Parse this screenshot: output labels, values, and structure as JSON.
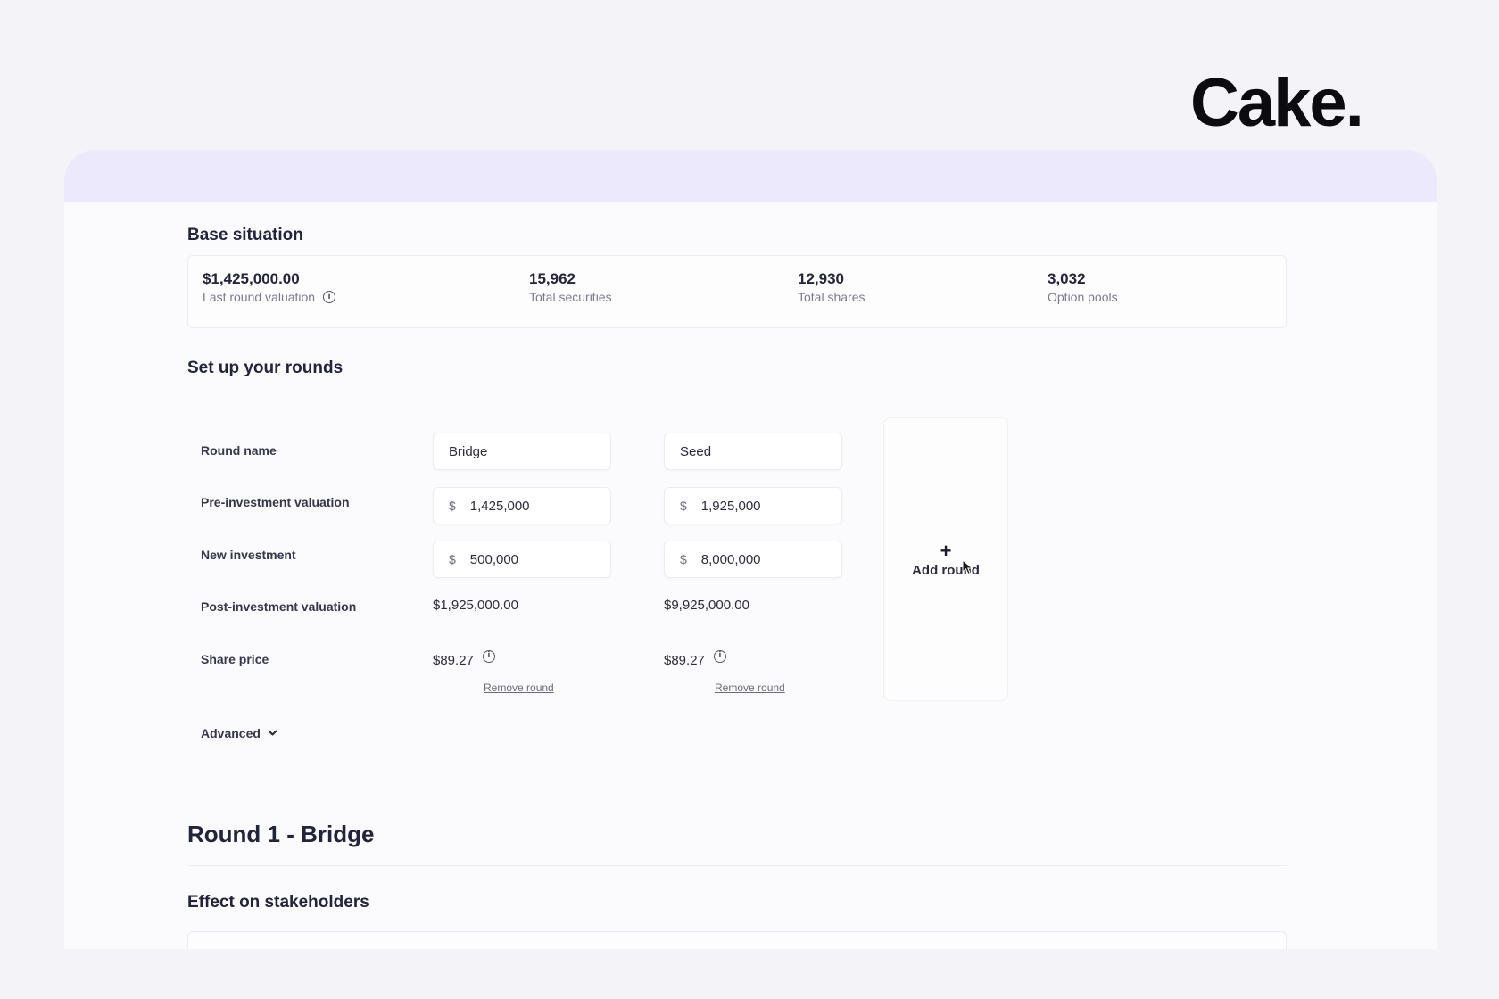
{
  "brand": {
    "name": "Cake."
  },
  "base": {
    "title": "Base situation",
    "stats": [
      {
        "value": "$1,425,000.00",
        "label": "Last round valuation",
        "info": true
      },
      {
        "value": "15,962",
        "label": "Total securities"
      },
      {
        "value": "12,930",
        "label": "Total shares"
      },
      {
        "value": "3,032",
        "label": "Option pools"
      }
    ]
  },
  "rounds": {
    "title": "Set up your rounds",
    "labels": {
      "name": "Round name",
      "pre": "Pre-investment valuation",
      "new": "New investment",
      "post": "Post-investment valuation",
      "price": "Share price"
    },
    "currency": "$",
    "items": [
      {
        "name": "Bridge",
        "pre": "1,425,000",
        "new": "500,000",
        "post": "$1,925,000.00",
        "price": "$89.27",
        "remove": "Remove round"
      },
      {
        "name": "Seed",
        "pre": "1,925,000",
        "new": "8,000,000",
        "post": "$9,925,000.00",
        "price": "$89.27",
        "remove": "Remove round"
      }
    ],
    "add_label": "Add round",
    "add_symbol": "+",
    "advanced": "Advanced"
  },
  "round1": {
    "title": "Round 1 - Bridge"
  },
  "effect": {
    "title": "Effect on stakeholders"
  },
  "colors": {
    "accent_band": "#ebe9fb",
    "background": "#f4f4f8"
  }
}
